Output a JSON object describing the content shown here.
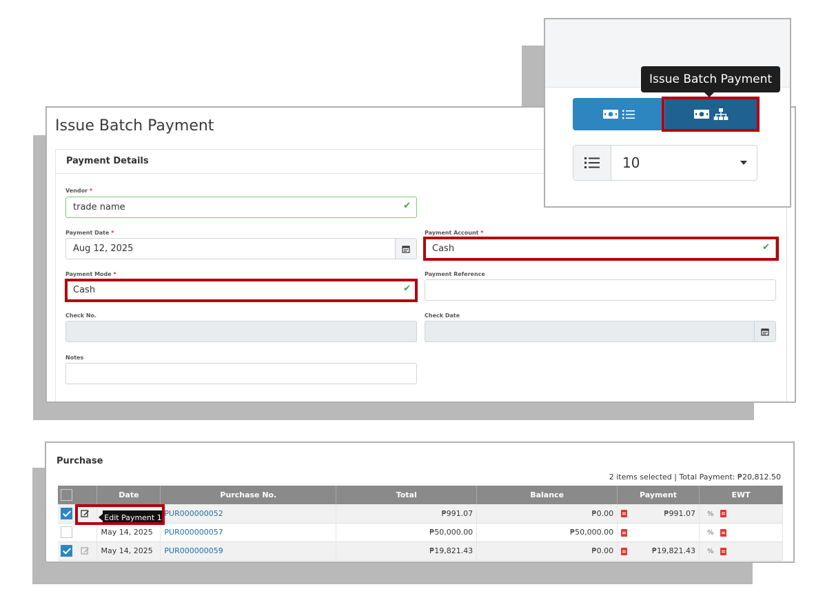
{
  "form": {
    "title": "Issue Batch Payment",
    "section_title": "Payment Details",
    "vendor": {
      "label": "Vendor",
      "required": "*",
      "value": "trade name"
    },
    "payment_date": {
      "label": "Payment Date",
      "required": "*",
      "value": "Aug 12, 2025"
    },
    "payment_account": {
      "label": "Payment Account",
      "required": "*",
      "value": "Cash"
    },
    "payment_mode": {
      "label": "Payment Mode",
      "required": "*",
      "value": "Cash"
    },
    "payment_reference": {
      "label": "Payment Reference",
      "value": ""
    },
    "check_no": {
      "label": "Check No.",
      "value": ""
    },
    "check_date": {
      "label": "Check Date",
      "value": ""
    },
    "notes": {
      "label": "Notes",
      "value": ""
    }
  },
  "popup": {
    "tooltip": "Issue Batch Payment",
    "page_size": "10"
  },
  "purchase": {
    "title": "Purchase",
    "summary": "2 items selected | Total Payment: ₱20,812.50",
    "columns": [
      "Date",
      "Purchase No.",
      "Total",
      "Balance",
      "Payment",
      "EWT"
    ],
    "edit_tooltip": "Edit Payment 1",
    "rows": [
      {
        "selected": true,
        "date": "",
        "purchase_no": "PUR000000052",
        "total": "₱991.07",
        "balance": "₱0.00",
        "payment": "₱991.07"
      },
      {
        "selected": false,
        "date": "May 14, 2025",
        "purchase_no": "PUR000000057",
        "total": "₱50,000.00",
        "balance": "₱50,000.00",
        "payment": ""
      },
      {
        "selected": true,
        "date": "May 14, 2025",
        "purchase_no": "PUR000000059",
        "total": "₱19,821.43",
        "balance": "₱0.00",
        "payment": "₱19,821.43"
      }
    ]
  },
  "colors": {
    "primary": "#2e86c1",
    "primary_dark": "#1f6190",
    "highlight": "#b5000b",
    "table_header": "#8a8a8a"
  }
}
